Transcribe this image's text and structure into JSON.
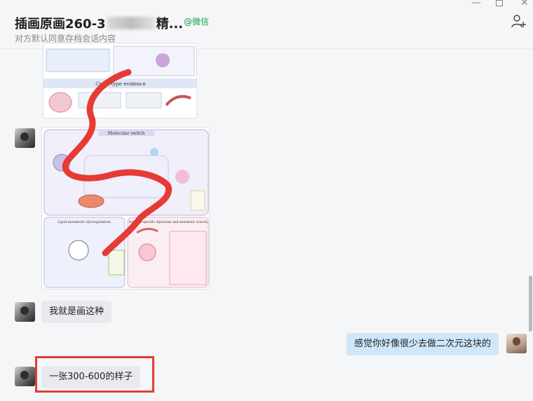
{
  "header": {
    "title_prefix": "插画原画260-3",
    "title_suffix": "精...",
    "wechat_tag": "@微信",
    "subtitle": "对方默认同意存档会话内容"
  },
  "images": {
    "top_panel_heading": "Cross-type evidence",
    "bottom_panel_heading": "Molecular switch",
    "lipid_heading": "Lipid metabolic dysregulation",
    "subtype_heading": "Subtype-specific injections and metabolic toxicity"
  },
  "messages": [
    {
      "side": "left",
      "text": "我就是画这种"
    },
    {
      "side": "right",
      "text": "感觉你好像很少去做二次元这块的"
    },
    {
      "side": "left",
      "text": "一张300-600的样子"
    }
  ],
  "colors": {
    "annotation_red": "#e53b34",
    "right_bubble": "#cfe6fb",
    "left_bubble": "#e9eaed",
    "wechat_green": "#16a34a"
  },
  "icons": {
    "minimize": "minimize-icon",
    "maximize": "maximize-icon",
    "close": "close-icon",
    "add_user": "add-user-icon"
  }
}
